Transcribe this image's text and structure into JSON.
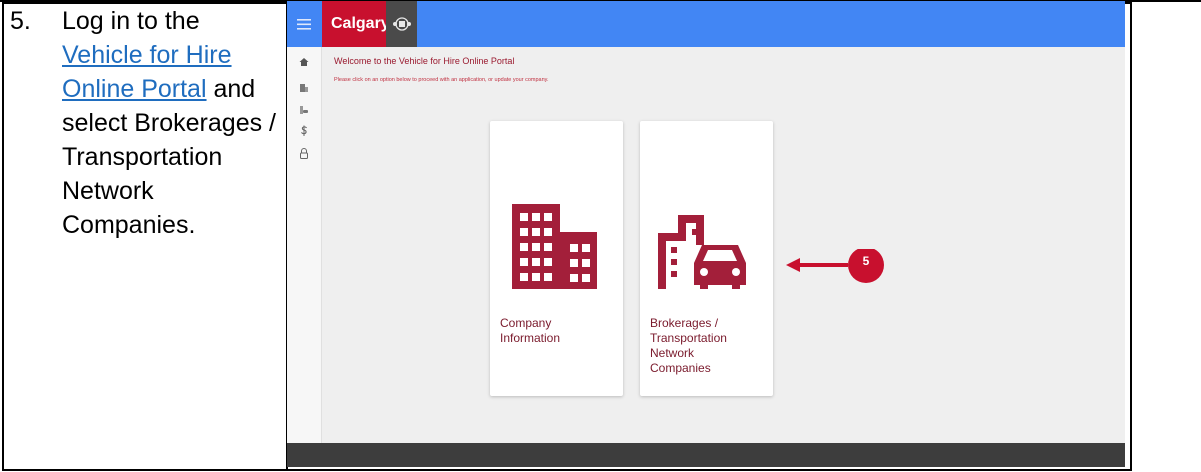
{
  "document": {
    "step_number": "5.",
    "step_text_before_link": "Log in to the",
    "link_text": "Vehicle for Hire Online Portal",
    "step_text_after_link": "and select Brokerages / Transportation Network Companies."
  },
  "portal": {
    "brand": "Calgary",
    "welcome_text": "Welcome to the Vehicle for Hire Online Portal",
    "instructions": "Please click on an option below to proceed with an application, or update your company.",
    "cards": [
      {
        "label": "Company\nInformation",
        "icon": "building-icon"
      },
      {
        "label": "Brokerages /\nTransportation\nNetwork\nCompanies",
        "icon": "building-car-icon"
      }
    ],
    "callout_number": "5",
    "sidebar_icons": [
      "home-icon",
      "building-icon",
      "building-car-icon",
      "dollar-icon",
      "lock-icon"
    ]
  },
  "colors": {
    "appbar": "#4286f4",
    "brand_red": "#c8102e",
    "icon_maroon": "#a31f3a",
    "callout": "#c8102e",
    "footer": "#3d3d3d"
  }
}
